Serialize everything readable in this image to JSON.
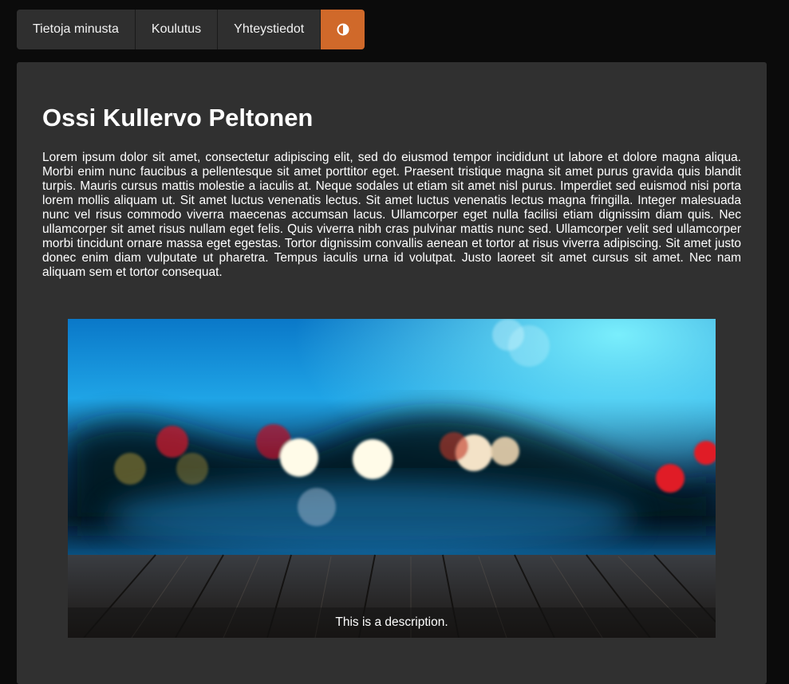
{
  "nav": {
    "items": [
      {
        "label": "Tietoja minusta"
      },
      {
        "label": "Koulutus"
      },
      {
        "label": "Yhteystiedot"
      }
    ],
    "theme_toggle_icon": "contrast-icon",
    "accent_color": "#d0692a"
  },
  "content": {
    "title": "Ossi Kullervo Peltonen",
    "intro": "Lorem ipsum dolor sit amet, consectetur adipiscing elit, sed do eiusmod tempor incididunt ut labore et dolore magna aliqua. Morbi enim nunc faucibus a pellentesque sit amet porttitor eget. Praesent tristique magna sit amet purus gravida quis blandit turpis. Mauris cursus mattis molestie a iaculis at. Neque sodales ut etiam sit amet nisl purus. Imperdiet sed euismod nisi porta lorem mollis aliquam ut. Sit amet luctus venenatis lectus. Sit amet luctus venenatis lectus magna fringilla. Integer malesuada nunc vel risus commodo viverra maecenas accumsan lacus. Ullamcorper eget nulla facilisi etiam dignissim diam quis. Nec ullamcorper sit amet risus nullam eget felis. Quis viverra nibh cras pulvinar mattis nunc sed. Ullamcorper velit sed ullamcorper morbi tincidunt ornare massa eget egestas. Tortor dignissim convallis aenean et tortor at risus viverra adipiscing. Sit amet justo donec enim diam vulputate ut pharetra. Tempus iaculis urna id volutpat. Justo laoreet sit amet cursus sit amet. Nec nam aliquam sem et tortor consequat.",
    "figure": {
      "caption": "This is a description."
    }
  }
}
